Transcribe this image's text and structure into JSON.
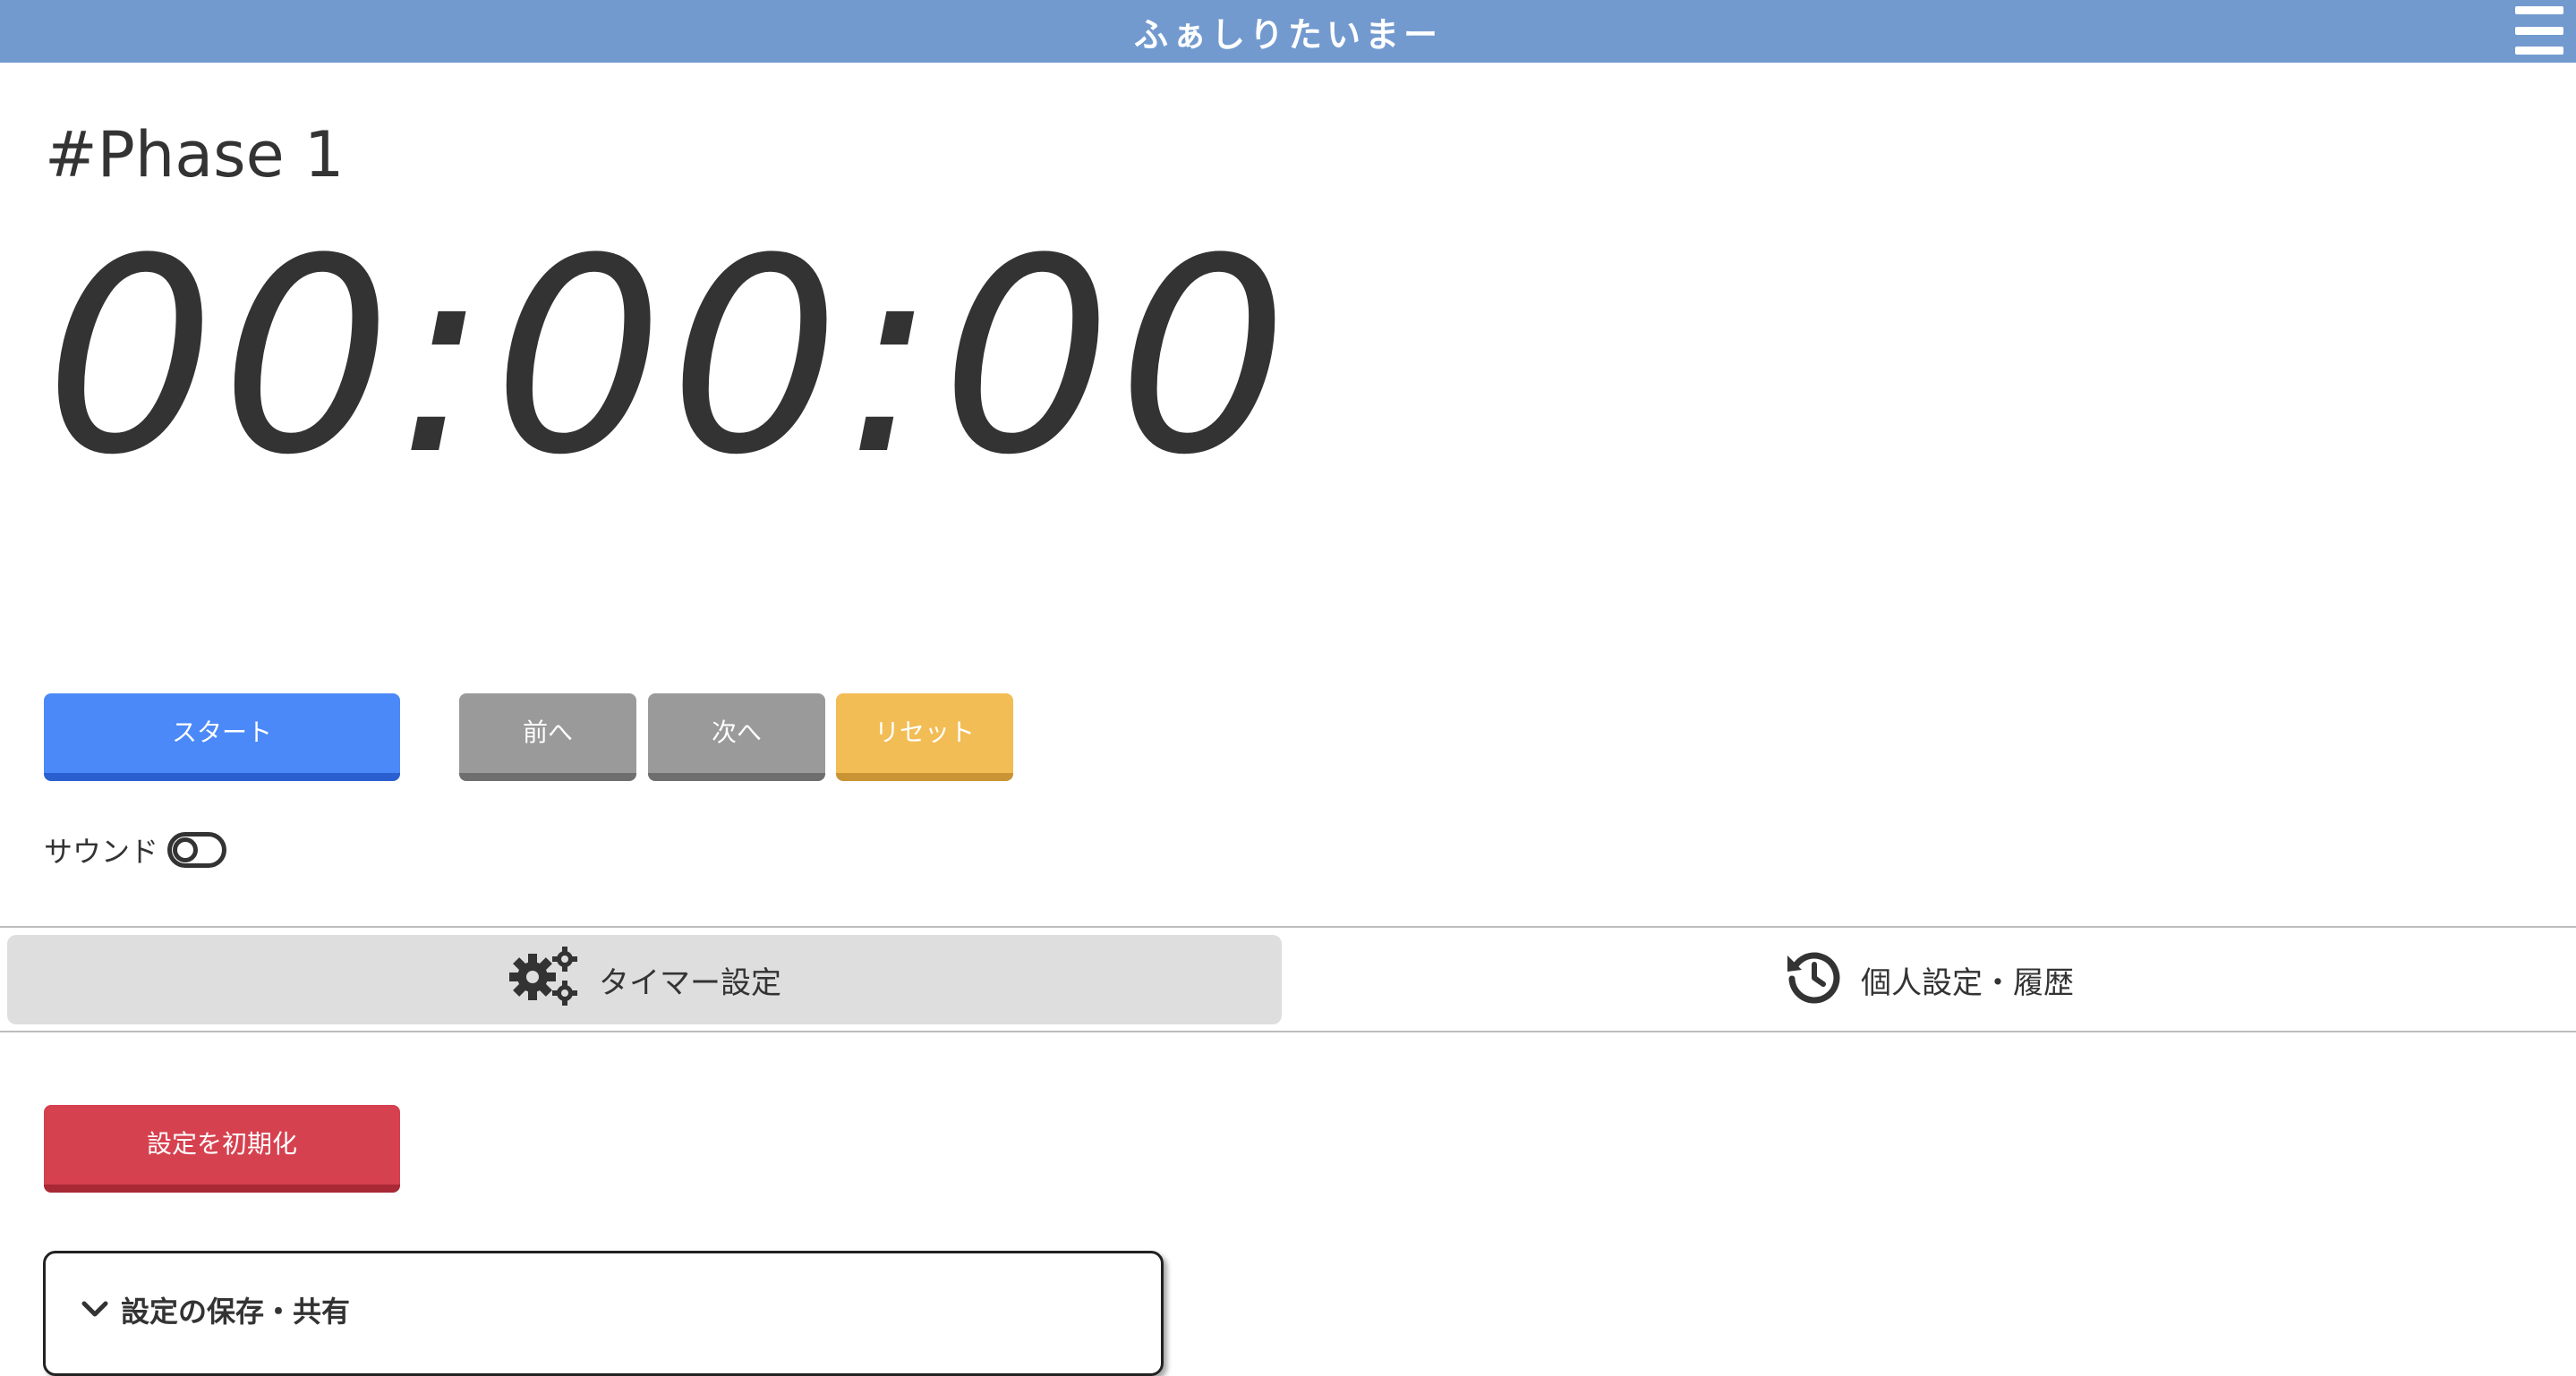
{
  "header": {
    "title": "ふぁしりたいまー",
    "menu_icon": "hamburger-menu-icon"
  },
  "timer": {
    "phase_label": "#Phase 1",
    "display": "00:00:00"
  },
  "controls": {
    "start_label": "スタート",
    "prev_label": "前へ",
    "next_label": "次へ",
    "reset_label": "リセット"
  },
  "sound": {
    "label": "サウンド",
    "enabled": false
  },
  "tabs": [
    {
      "label": "タイマー設定",
      "icon": "gears-icon",
      "active": true
    },
    {
      "label": "個人設定・履歴",
      "icon": "history-icon",
      "active": false
    }
  ],
  "settings": {
    "reset_settings_label": "設定を初期化",
    "save_share_title": "設定の保存・共有"
  },
  "colors": {
    "header": "#729acf",
    "start": "#4c89f8",
    "neutral": "#9a9a9a",
    "reset": "#f2bd55",
    "danger": "#d6414f"
  }
}
